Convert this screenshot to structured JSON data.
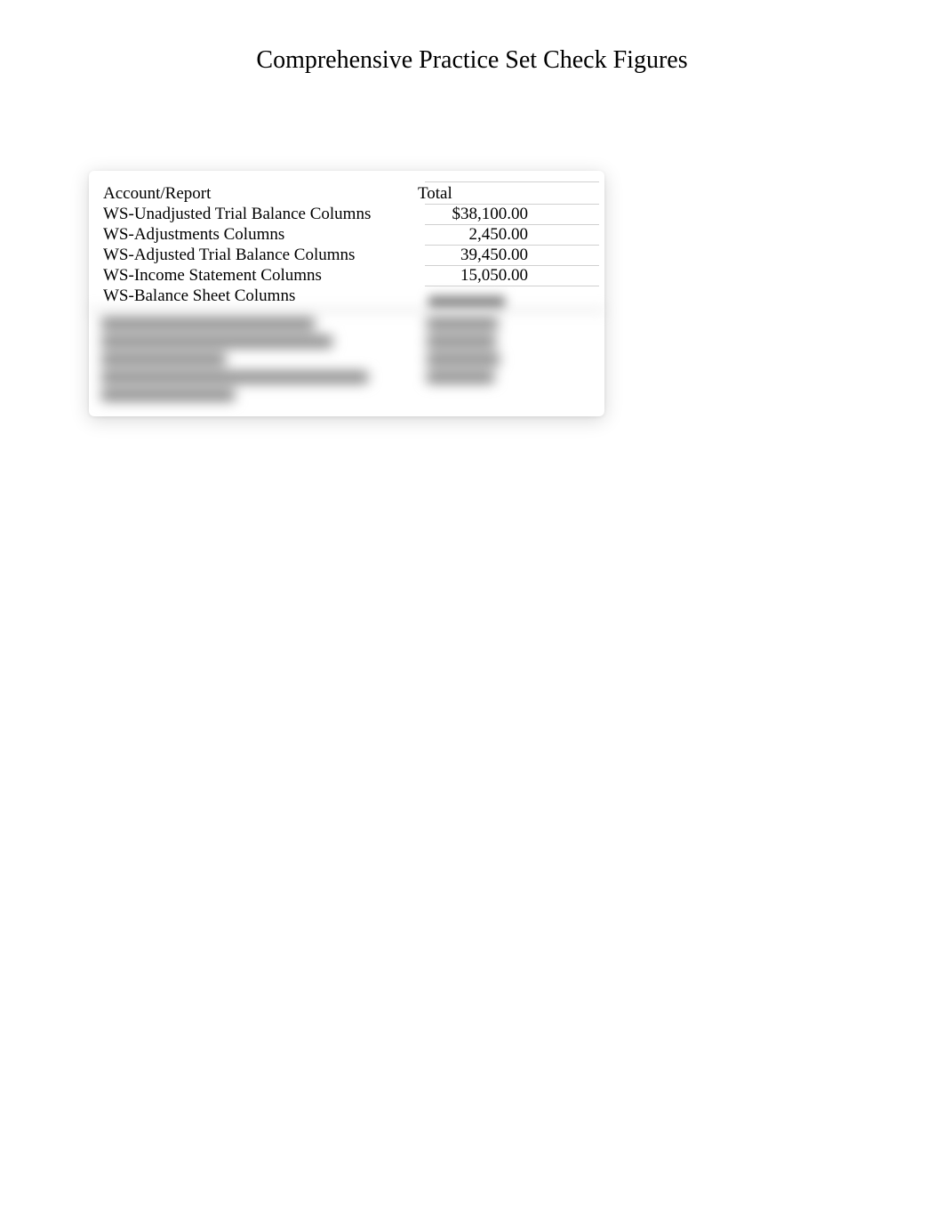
{
  "title": "Comprehensive Practice Set Check Figures",
  "table": {
    "header": {
      "label": "Account/Report",
      "total": "Total"
    },
    "rows": [
      {
        "label": "WS-Unadjusted Trial Balance Columns",
        "total": "$38,100.00"
      },
      {
        "label": "WS-Adjustments Columns",
        "total": "2,450.00"
      },
      {
        "label": "WS-Adjusted Trial Balance Columns",
        "total": "39,450.00"
      },
      {
        "label": "WS-Income Statement Columns",
        "total": "15,050.00"
      },
      {
        "label": "WS-Balance Sheet Columns",
        "total": ""
      }
    ]
  }
}
